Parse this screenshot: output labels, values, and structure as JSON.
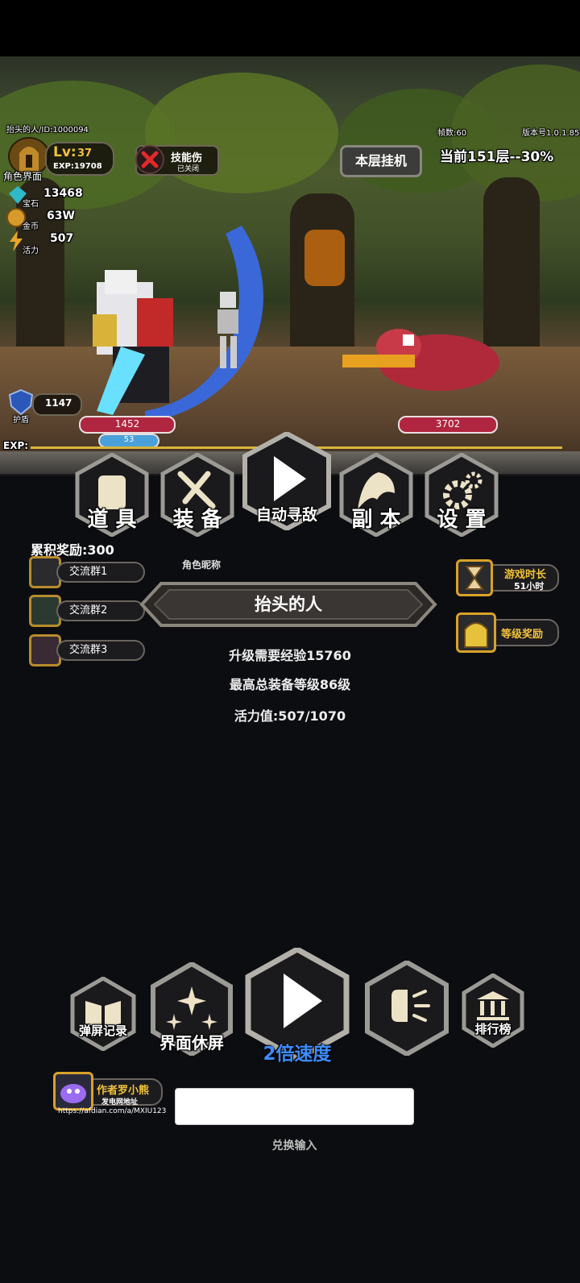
{
  "player": {
    "name_id": "抬头的人/ID:1000094",
    "portrait_label": "角色界面",
    "level_prefix": "Lv:",
    "level": "37",
    "exp_label": "EXP:19708"
  },
  "resources": {
    "gem_label": "宝石",
    "gem_value": "13468",
    "gold_label": "金币",
    "gold_value": "63W",
    "stamina_label": "活力",
    "stamina_value": "507"
  },
  "skill_damage": {
    "label": "技能伤",
    "state": "已关闭"
  },
  "header": {
    "fps": "帧数:60",
    "version": "版本号1.0.1.85",
    "idle_button": "本层挂机",
    "floor_progress": "当前151层--30%"
  },
  "battle": {
    "shield_value": "1147",
    "shield_label": "护盾",
    "player_hp": "1452",
    "player_mana": "53",
    "enemy_hp": "3702",
    "exp_bar_label": "EXP:"
  },
  "main_menu": [
    {
      "label": "道 具",
      "icon": "scroll-icon"
    },
    {
      "label": "装 备",
      "icon": "sword-icon"
    },
    {
      "label": "自动寻敌",
      "icon": "play-icon"
    },
    {
      "label": "副 本",
      "icon": "dragon-icon"
    },
    {
      "label": "设 置",
      "icon": "gear-icon"
    }
  ],
  "rewards": {
    "accumulated": "累积奖励:300",
    "groups": [
      "交流群1",
      "交流群2",
      "交流群3"
    ],
    "playtime_label": "游戏时长",
    "playtime_value": "51小时",
    "level_reward": "等级奖励"
  },
  "profile": {
    "nickname_label": "角色昵称",
    "nickname": "抬头的人",
    "exp_needed": "升级需要经验15760",
    "max_equip_level": "最高总装备等级86级",
    "stamina": "活力值:507/1070"
  },
  "bottom_menu": [
    {
      "label": "弹屏记录",
      "icon": "book-icon"
    },
    {
      "label": "界面休屏",
      "icon": "sparkles-icon"
    },
    {
      "label": "2倍速度",
      "icon": "play-icon"
    },
    {
      "label": "",
      "icon": "light-icon"
    },
    {
      "label": "排行榜",
      "icon": "bank-icon"
    }
  ],
  "author": {
    "name": "作者罗小熊",
    "subtitle": "发电网地址",
    "url": "https://afdian.com/a/MXIU123"
  },
  "redeem": {
    "input_value": "",
    "label": "兑换输入"
  },
  "colors": {
    "accent_gold": "#f2c23a",
    "hp_red": "#b0253f",
    "mana_blue": "#4aa0d8",
    "speed_blue": "#3d8cff"
  }
}
